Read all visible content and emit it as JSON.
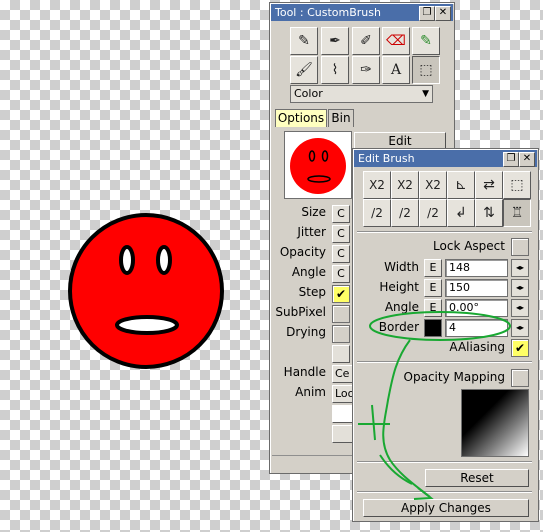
{
  "tool_window": {
    "title": "Tool : CustomBrush",
    "dropdown_value": "Color",
    "tabs": [
      "Options",
      "Bin"
    ],
    "edit_label": "Edit",
    "params": [
      {
        "label": "Size",
        "value": "C"
      },
      {
        "label": "Jitter",
        "value": "C"
      },
      {
        "label": "Opacity",
        "value": "C"
      },
      {
        "label": "Angle",
        "value": "C"
      },
      {
        "label": "Step",
        "value": "✔"
      },
      {
        "label": "SubPixel",
        "value": ""
      },
      {
        "label": "Drying",
        "value": ""
      },
      {
        "label": "Handle",
        "value": "Ce"
      },
      {
        "label": "Anim",
        "value": "Loo"
      }
    ]
  },
  "edit_brush": {
    "title": "Edit Brush",
    "row1_icons": [
      "X2",
      "X2",
      "X2",
      "flip-icon",
      "swap-icon",
      "crop-icon"
    ],
    "row2_icons": [
      "/2",
      "/2",
      "/2",
      "rotate-icon",
      "swap-icon",
      "brush-icon"
    ],
    "lock_aspect": "Lock Aspect",
    "e_label": "E",
    "width_label": "Width",
    "width_value": "148",
    "height_label": "Height",
    "height_value": "150",
    "angle_label": "Angle",
    "angle_value": "0.00°",
    "border_label": "Border",
    "border_value": "4",
    "aaliasing_label": "AAliasing",
    "opacity_mapping_label": "Opacity Mapping",
    "reset_label": "Reset",
    "apply_label": "Apply Changes",
    "spinner_glyph": "◂▸"
  },
  "colors": {
    "brush_red": "#ff0000",
    "title_blue": "#4a6ea9",
    "annotation_green": "#19a832",
    "panel_bg": "#d4d0c8"
  }
}
